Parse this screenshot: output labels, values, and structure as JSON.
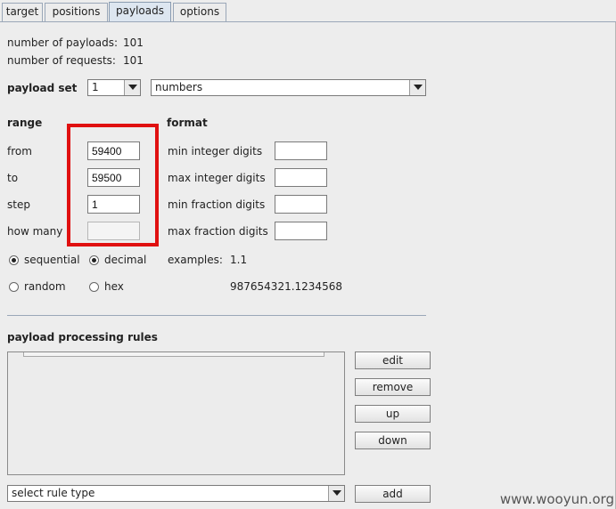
{
  "tabs": [
    "target",
    "positions",
    "payloads",
    "options"
  ],
  "summary": {
    "payloads_label": "number of payloads:",
    "payloads_value": "101",
    "requests_label": "number of requests:",
    "requests_value": "101"
  },
  "payload_set": {
    "label": "payload set",
    "set_value": "1",
    "type_value": "numbers"
  },
  "range": {
    "heading": "range",
    "from_label": "from",
    "from_value": "59400",
    "to_label": "to",
    "to_value": "59500",
    "step_label": "step",
    "step_value": "1",
    "how_many_label": "how many",
    "how_many_value": "",
    "sequential_label": "sequential",
    "random_label": "random",
    "selected": "sequential"
  },
  "format": {
    "heading": "format",
    "min_integer_label": "min integer digits",
    "max_integer_label": "max integer digits",
    "min_fraction_label": "min fraction digits",
    "max_fraction_label": "max fraction digits",
    "decimal_label": "decimal",
    "hex_label": "hex",
    "selected": "decimal",
    "examples_label": "examples:",
    "example_1": "1.1",
    "example_2": "987654321.1234568"
  },
  "processing": {
    "heading": "payload processing rules",
    "buttons": [
      "edit",
      "remove",
      "up",
      "down"
    ],
    "rule_type_value": "select rule type",
    "add_label": "add"
  },
  "watermark": "www.wooyun.org"
}
